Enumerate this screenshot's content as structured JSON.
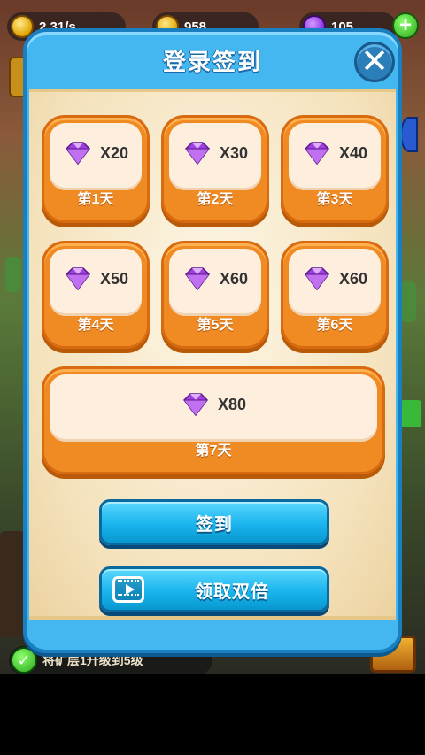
{
  "hud": {
    "gold_rate": "2.31/s",
    "coins": "958",
    "gems": "105",
    "plus_icon": "plus-icon"
  },
  "quest": {
    "text": "将矿层1升级到5级"
  },
  "dialog": {
    "title": "登录签到",
    "close_label": "✕",
    "days": [
      {
        "reward": "X20",
        "label": "第1天"
      },
      {
        "reward": "X30",
        "label": "第2天"
      },
      {
        "reward": "X40",
        "label": "第3天"
      },
      {
        "reward": "X50",
        "label": "第4天"
      },
      {
        "reward": "X60",
        "label": "第5天"
      },
      {
        "reward": "X60",
        "label": "第6天"
      },
      {
        "reward": "X80",
        "label": "第7天"
      }
    ],
    "checkin_label": "签到",
    "double_label": "领取双倍"
  },
  "colors": {
    "dialog_blue": "#45b7f0",
    "card_orange": "#f08a22",
    "button_cyan": "#1ab4ec",
    "gem_purple": "#a040e0"
  }
}
